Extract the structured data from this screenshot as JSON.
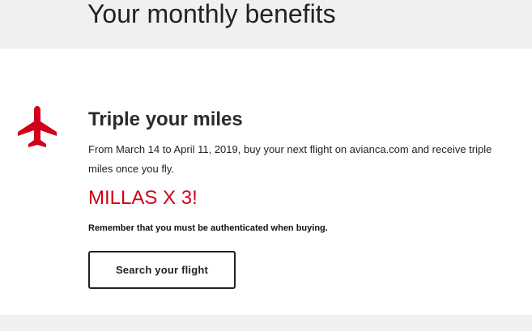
{
  "header": {
    "title": "Your monthly benefits"
  },
  "benefit": {
    "icon": "airplane-icon",
    "title": "Triple your miles",
    "description": "From March 14 to April 11, 2019, buy your next flight on avianca.com and receive triple miles once you fly.",
    "promo": "MILLAS X 3!",
    "note": "Remember that you must be authenticated when buying.",
    "button_label": "Search your flight"
  },
  "colors": {
    "accent": "#d0021b",
    "band": "#f0f0f0",
    "text": "#222222"
  }
}
